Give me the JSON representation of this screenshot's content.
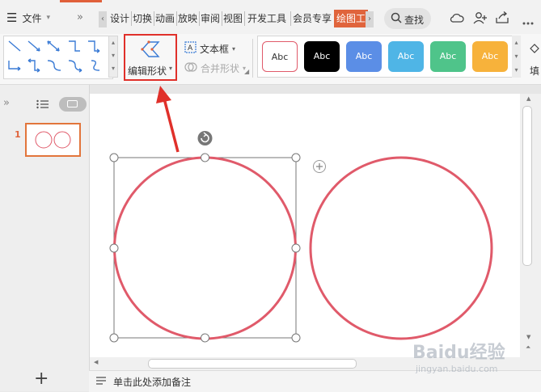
{
  "menu": {
    "file_label": "文件"
  },
  "tabs": [
    {
      "label": "设计"
    },
    {
      "label": "切换"
    },
    {
      "label": "动画"
    },
    {
      "label": "放映"
    },
    {
      "label": "审阅"
    },
    {
      "label": "视图"
    },
    {
      "label": "开发工具"
    },
    {
      "label": "会员专享"
    },
    {
      "label": "绘图工"
    }
  ],
  "search": {
    "label": "查找"
  },
  "ribbon": {
    "edit_shape_label": "编辑形状",
    "text_box_label": "文本框",
    "merge_shape_label": "合并形状",
    "styles": [
      {
        "label": "Abc",
        "bg": "#ffffff",
        "fg": "#333333",
        "border": "#e05a6a"
      },
      {
        "label": "Abc",
        "bg": "#000000",
        "fg": "#ffffff",
        "border": "#000000"
      },
      {
        "label": "Abc",
        "bg": "#5b8ee6",
        "fg": "#ffffff",
        "border": "#5b8ee6"
      },
      {
        "label": "Abc",
        "bg": "#4fb5e6",
        "fg": "#ffffff",
        "border": "#4fb5e6"
      },
      {
        "label": "Abc",
        "bg": "#4fc48a",
        "fg": "#ffffff",
        "border": "#4fc48a"
      },
      {
        "label": "Abc",
        "bg": "#f7b23b",
        "fg": "#ffffff",
        "border": "#f7b23b"
      }
    ],
    "fill_label_partial": "填"
  },
  "slides": {
    "current_number": "1"
  },
  "notes": {
    "placeholder": "单击此处添加备注"
  },
  "watermark": {
    "brand": "Baidu经验",
    "url": "jingyan.baidu.com"
  },
  "colors": {
    "accent": "#e0643c",
    "circle_stroke": "#e05a6a",
    "annotation_red": "#e0302a"
  }
}
